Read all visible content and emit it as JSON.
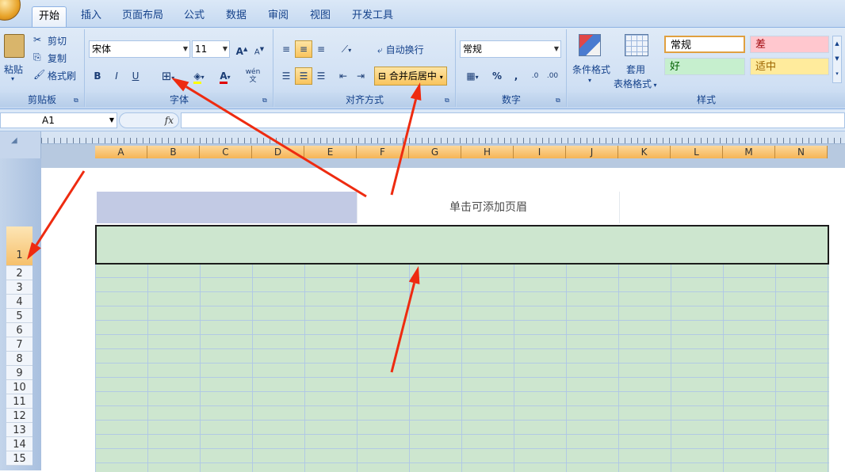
{
  "tabs": [
    {
      "label": "开始",
      "active": true
    },
    {
      "label": "插入"
    },
    {
      "label": "页面布局"
    },
    {
      "label": "公式"
    },
    {
      "label": "数据"
    },
    {
      "label": "审阅"
    },
    {
      "label": "视图"
    },
    {
      "label": "开发工具"
    }
  ],
  "clipboard": {
    "paste": "粘贴",
    "cut": "剪切",
    "copy": "复制",
    "format_painter": "格式刷",
    "label": "剪贴板"
  },
  "font": {
    "name": "宋体",
    "size": "11",
    "bold": "B",
    "italic": "I",
    "underline": "U",
    "phonetic": "wén",
    "label": "字体"
  },
  "alignment": {
    "wrap_text": "自动换行",
    "merge_center": "合并后居中",
    "label": "对齐方式"
  },
  "number": {
    "format": "常规",
    "percent": "%",
    "comma": ",",
    "label": "数字"
  },
  "styles_group": {
    "conditional": "条件格式",
    "table_format_1": "套用",
    "table_format_2": "表格格式",
    "label": "样式",
    "cells": [
      {
        "label": "常规",
        "bg": "#ffffff",
        "fg": "#000000"
      },
      {
        "label": "差",
        "bg": "#ffc7ce",
        "fg": "#9c0006"
      },
      {
        "label": "好",
        "bg": "#c6efce",
        "fg": "#006100"
      },
      {
        "label": "适中",
        "bg": "#ffeb9c",
        "fg": "#9c6500"
      }
    ]
  },
  "formula_bar": {
    "cell_ref": "A1",
    "fx": "fx"
  },
  "columns": [
    "A",
    "B",
    "C",
    "D",
    "E",
    "F",
    "G",
    "H",
    "I",
    "J",
    "K",
    "L",
    "M",
    "N"
  ],
  "rows": [
    "1",
    "2",
    "3",
    "4",
    "5",
    "6",
    "7",
    "8",
    "9",
    "10",
    "11",
    "12",
    "13",
    "14",
    "15"
  ],
  "page_header": {
    "hint": "单击可添加页眉"
  },
  "colors": {
    "arrow": "#ee2b10",
    "selection": "#cde6cf",
    "accent": "#15428b"
  }
}
